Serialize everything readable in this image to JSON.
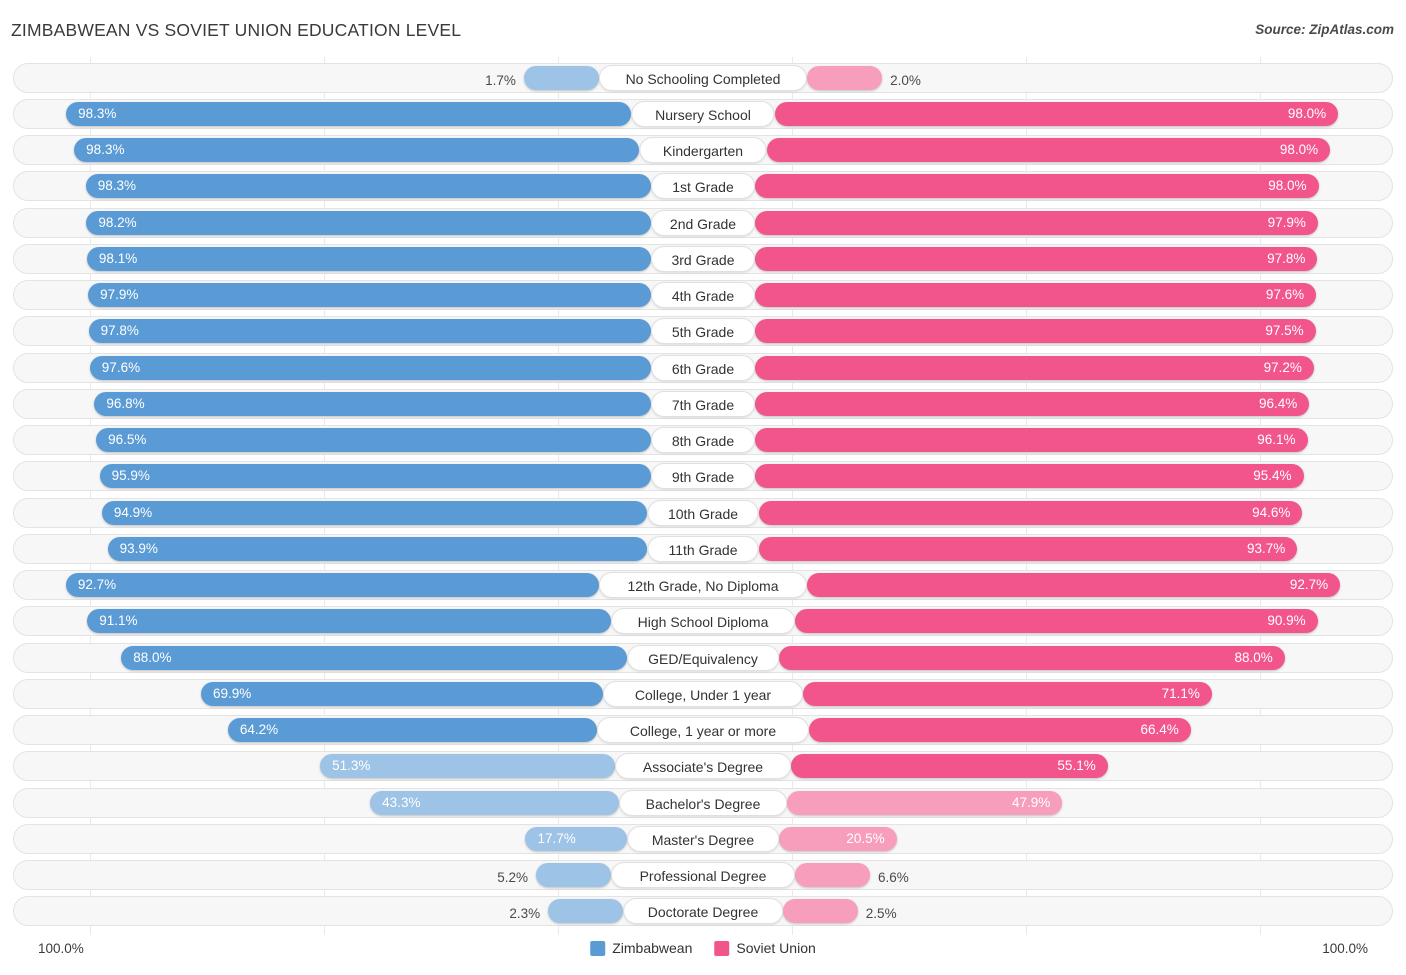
{
  "header": {
    "title": "ZIMBABWEAN VS SOVIET UNION EDUCATION LEVEL",
    "source": "Source: ZipAtlas.com"
  },
  "footer": {
    "axis_left": "100.0%",
    "axis_right": "100.0%",
    "legend": [
      {
        "label": "Zimbabwean",
        "color": "#5b9bd5"
      },
      {
        "label": "Soviet Union",
        "color": "#f2558b"
      }
    ]
  },
  "chart_data": {
    "type": "bar",
    "title": "ZIMBABWEAN VS SOVIET UNION EDUCATION LEVEL",
    "orientation": "horizontal-diverging",
    "xlabel": "",
    "ylabel": "",
    "xlim": [
      0,
      100
    ],
    "grid": true,
    "legend_position": "bottom-center",
    "categories": [
      "No Schooling Completed",
      "Nursery School",
      "Kindergarten",
      "1st Grade",
      "2nd Grade",
      "3rd Grade",
      "4th Grade",
      "5th Grade",
      "6th Grade",
      "7th Grade",
      "8th Grade",
      "9th Grade",
      "10th Grade",
      "11th Grade",
      "12th Grade, No Diploma",
      "High School Diploma",
      "GED/Equivalency",
      "College, Under 1 year",
      "College, 1 year or more",
      "Associate's Degree",
      "Bachelor's Degree",
      "Master's Degree",
      "Professional Degree",
      "Doctorate Degree"
    ],
    "series": [
      {
        "name": "Zimbabwean",
        "color": "#5b9bd5",
        "values": [
          1.7,
          98.3,
          98.3,
          98.3,
          98.2,
          98.1,
          97.9,
          97.8,
          97.6,
          96.8,
          96.5,
          95.9,
          94.9,
          93.9,
          92.7,
          91.1,
          88.0,
          69.9,
          64.2,
          51.3,
          43.3,
          17.7,
          5.2,
          2.3
        ],
        "labels": [
          "1.7%",
          "98.3%",
          "98.3%",
          "98.3%",
          "98.2%",
          "98.1%",
          "97.9%",
          "97.8%",
          "97.6%",
          "96.8%",
          "96.5%",
          "95.9%",
          "94.9%",
          "93.9%",
          "92.7%",
          "91.1%",
          "88.0%",
          "69.9%",
          "64.2%",
          "51.3%",
          "43.3%",
          "17.7%",
          "5.2%",
          "2.3%"
        ]
      },
      {
        "name": "Soviet Union",
        "color": "#f2558b",
        "values": [
          2.0,
          98.0,
          98.0,
          98.0,
          97.9,
          97.8,
          97.6,
          97.5,
          97.2,
          96.4,
          96.1,
          95.4,
          94.6,
          93.7,
          92.7,
          90.9,
          88.0,
          71.1,
          66.4,
          55.1,
          47.9,
          20.5,
          6.6,
          2.5
        ],
        "labels": [
          "2.0%",
          "98.0%",
          "98.0%",
          "98.0%",
          "97.9%",
          "97.8%",
          "97.6%",
          "97.5%",
          "97.2%",
          "96.4%",
          "96.1%",
          "95.4%",
          "94.6%",
          "93.7%",
          "92.7%",
          "90.9%",
          "88.0%",
          "71.1%",
          "66.4%",
          "55.1%",
          "47.9%",
          "20.5%",
          "6.6%",
          "2.5%"
        ]
      }
    ]
  }
}
